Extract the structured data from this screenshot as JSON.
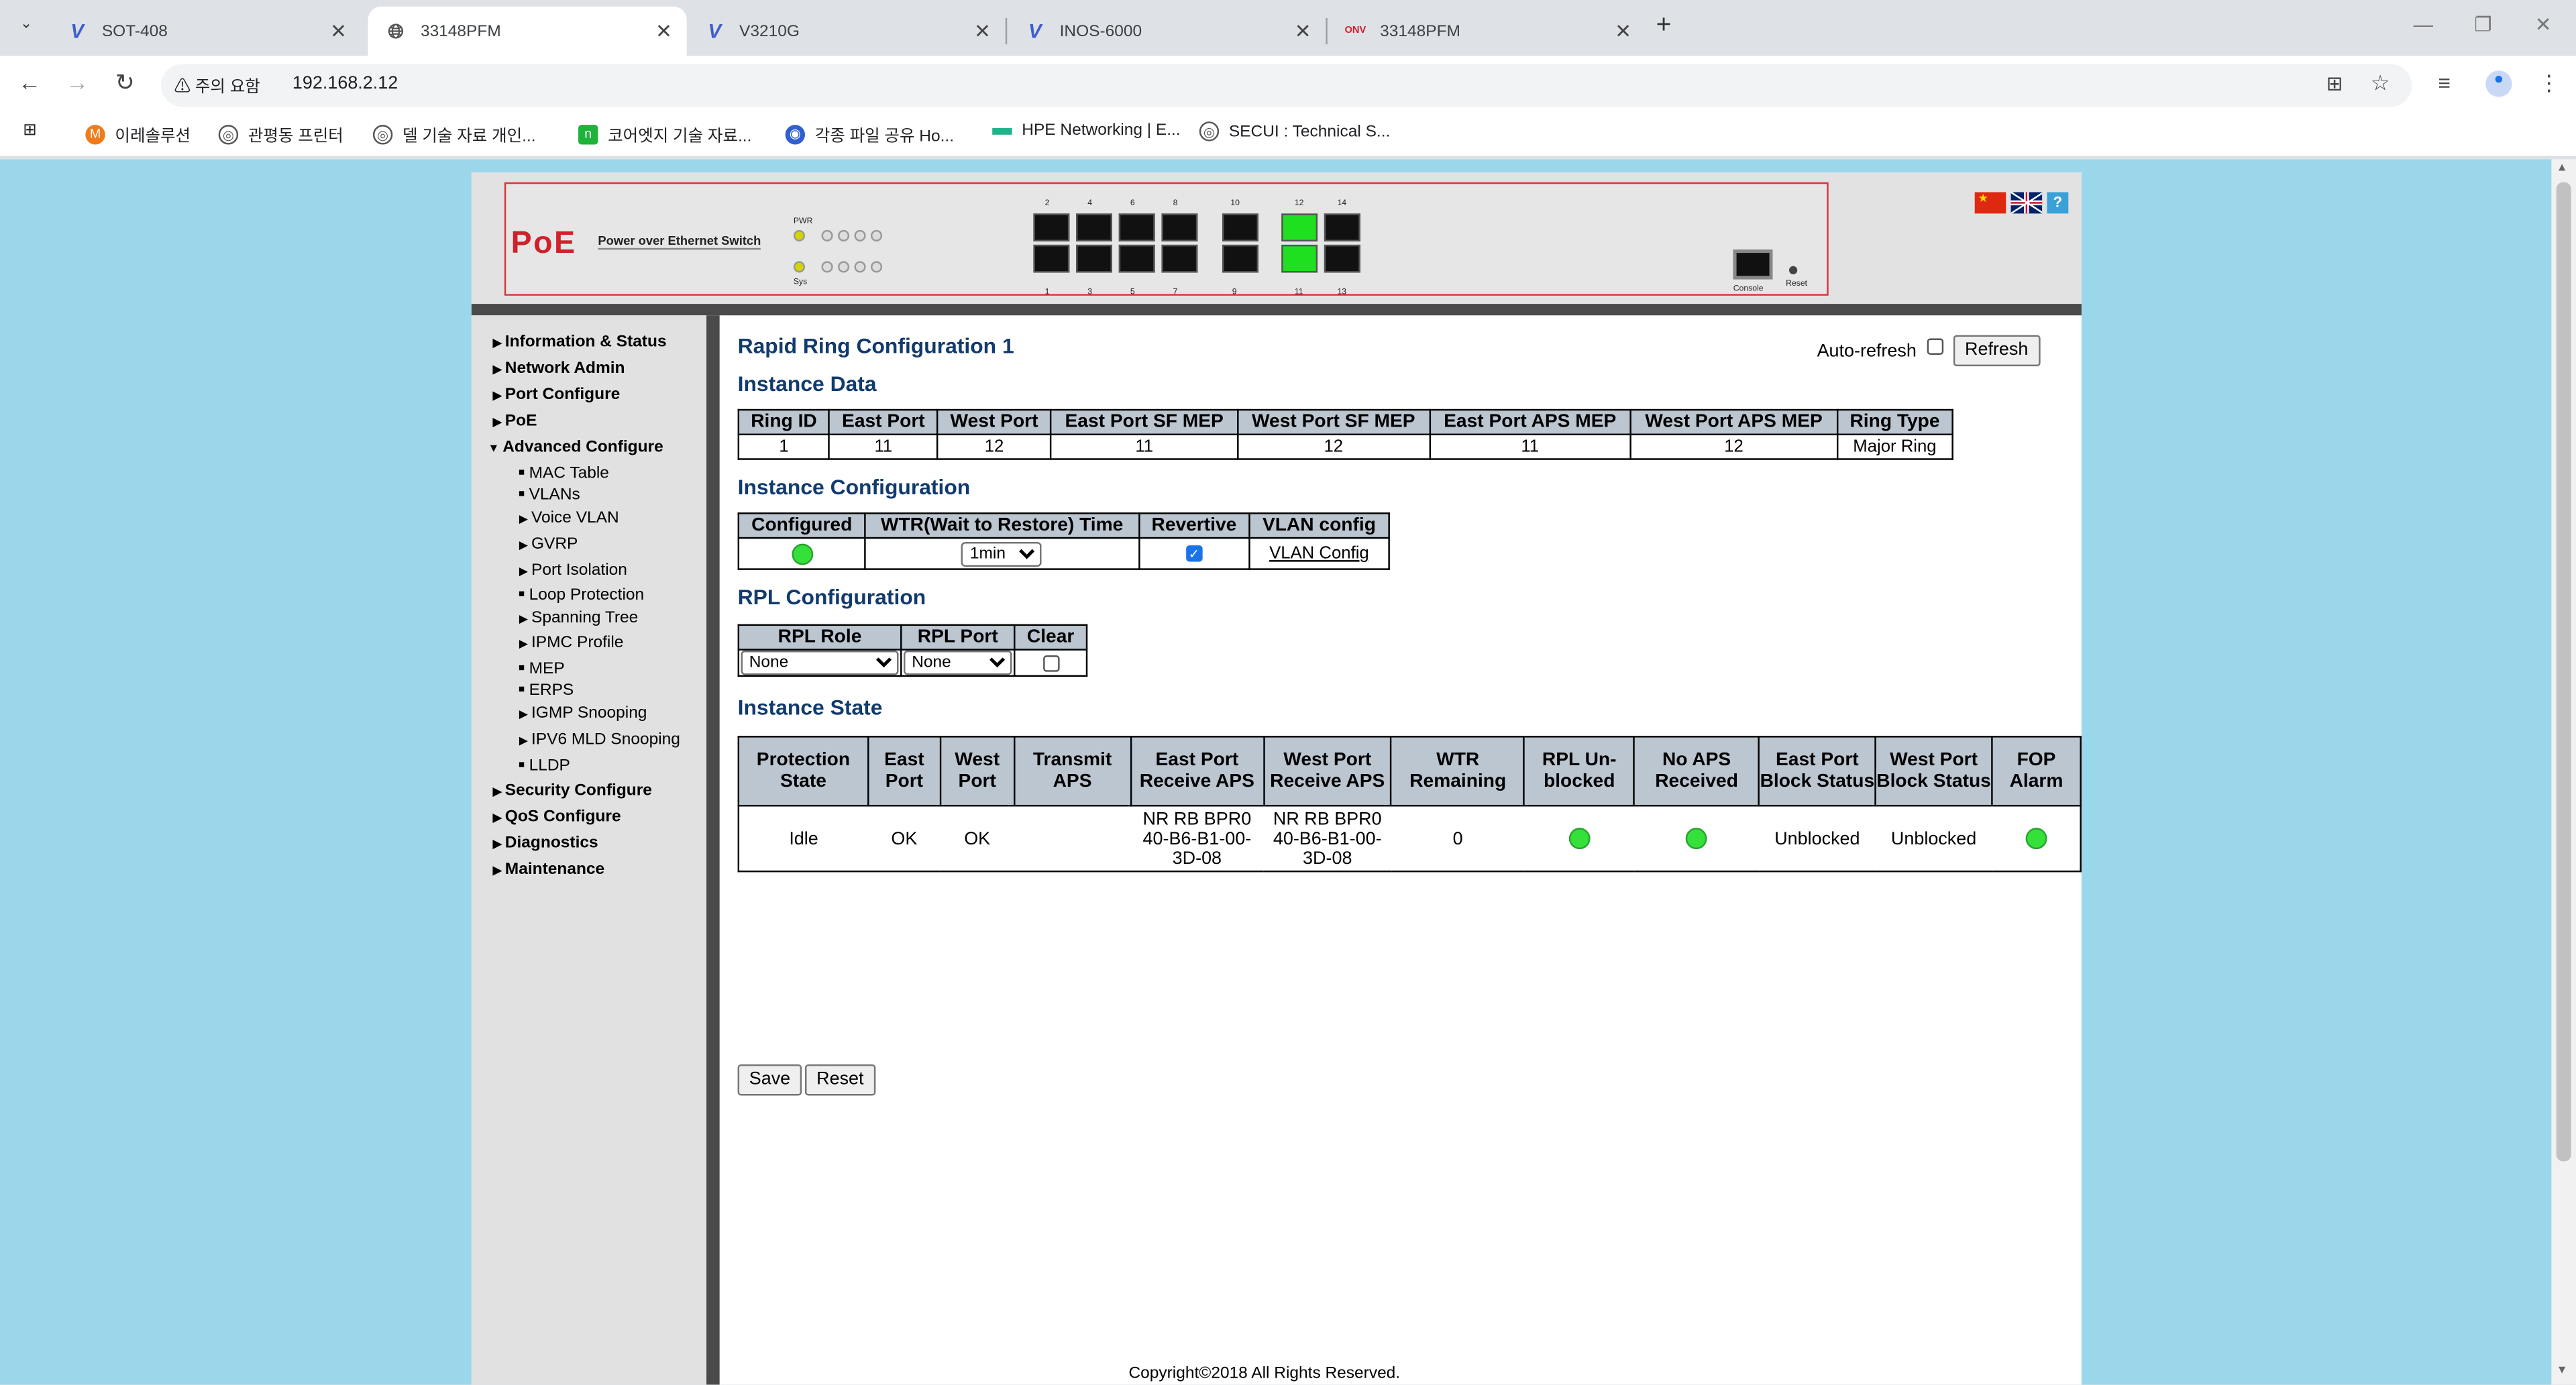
{
  "browser": {
    "tabs": [
      {
        "title": "SOT-408",
        "icon": "v-logo-icon"
      },
      {
        "title": "33148PFM",
        "icon": "globe-icon"
      },
      {
        "title": "V3210G",
        "icon": "v-logo-icon"
      },
      {
        "title": "INOS-6000",
        "icon": "v-logo-icon"
      },
      {
        "title": "33148PFM",
        "icon": "onv-logo-icon"
      }
    ],
    "security_label": "주의 요함",
    "url": "192.168.2.12",
    "bookmarks": [
      "이레솔루션",
      "관평동 프린터",
      "델 기술 자료 개인...",
      "코어엣지 기술 자료...",
      "각종 파일 공유 Ho...",
      "HPE Networking | E...",
      "SECUI : Technical S..."
    ]
  },
  "device": {
    "logo": "PoE",
    "logo_text": "Power over Ethernet Switch",
    "led_labels": [
      "PWR",
      "Sys"
    ],
    "top_ports": [
      "2",
      "4",
      "6",
      "8",
      "10",
      "12",
      "14"
    ],
    "bottom_ports": [
      "1",
      "3",
      "5",
      "7",
      "9",
      "11",
      "13"
    ],
    "console_label": "Console",
    "reset_label": "Reset"
  },
  "nav": {
    "top": [
      "Information & Status",
      "Network Admin",
      "Port Configure",
      "PoE",
      "Advanced Configure"
    ],
    "advanced_sub": [
      "MAC Table",
      "VLANs",
      "Voice VLAN",
      "GVRP",
      "Port Isolation",
      "Loop Protection",
      "Spanning Tree",
      "IPMC Profile",
      "MEP",
      "ERPS",
      "IGMP Snooping",
      "IPV6 MLD Snooping",
      "LLDP"
    ],
    "bottom": [
      "Security Configure",
      "QoS Configure",
      "Diagnostics",
      "Maintenance"
    ]
  },
  "main": {
    "title": "Rapid Ring Configuration 1",
    "auto_refresh_label": "Auto-refresh",
    "refresh_button": "Refresh",
    "instance_data": {
      "heading": "Instance Data",
      "headers": [
        "Ring ID",
        "East Port",
        "West Port",
        "East Port SF MEP",
        "West Port SF MEP",
        "East Port APS MEP",
        "West Port APS MEP",
        "Ring Type"
      ],
      "row": [
        "1",
        "11",
        "12",
        "11",
        "12",
        "11",
        "12",
        "Major Ring"
      ]
    },
    "instance_config": {
      "heading": "Instance Configuration",
      "headers": [
        "Configured",
        "WTR(Wait to Restore) Time",
        "Revertive",
        "VLAN config"
      ],
      "wtr_value": "1min",
      "vlan_link": "VLAN Config"
    },
    "rpl_config": {
      "heading": "RPL Configuration",
      "headers": [
        "RPL Role",
        "RPL Port",
        "Clear"
      ],
      "role_value": "None",
      "port_value": "None"
    },
    "instance_state": {
      "heading": "Instance State",
      "headers": [
        "Protection State",
        "East Port",
        "West Port",
        "Transmit APS",
        "East Port Receive APS",
        "West Port Receive APS",
        "WTR Remaining",
        "RPL Un-blocked",
        "No APS Received",
        "East Port Block Status",
        "West Port Block Status",
        "FOP Alarm"
      ],
      "protection_state": "Idle",
      "east_port": "OK",
      "west_port": "OK",
      "transmit_aps": "",
      "east_receive_aps": "NR RB BPR0 40-B6-B1-00-3D-08",
      "west_receive_aps": "NR RB BPR0 40-B6-B1-00-3D-08",
      "wtr_remaining": "0",
      "east_block_status": "Unblocked",
      "west_block_status": "Unblocked"
    },
    "save_button": "Save",
    "reset_button": "Reset",
    "copyright": "Copyright©2018 All Rights Reserved."
  },
  "colors": {
    "page_bg": "#9bd7ea",
    "header_blue": "#113a6e",
    "status_green": "#35e03a",
    "table_header": "#bcc6d1"
  }
}
